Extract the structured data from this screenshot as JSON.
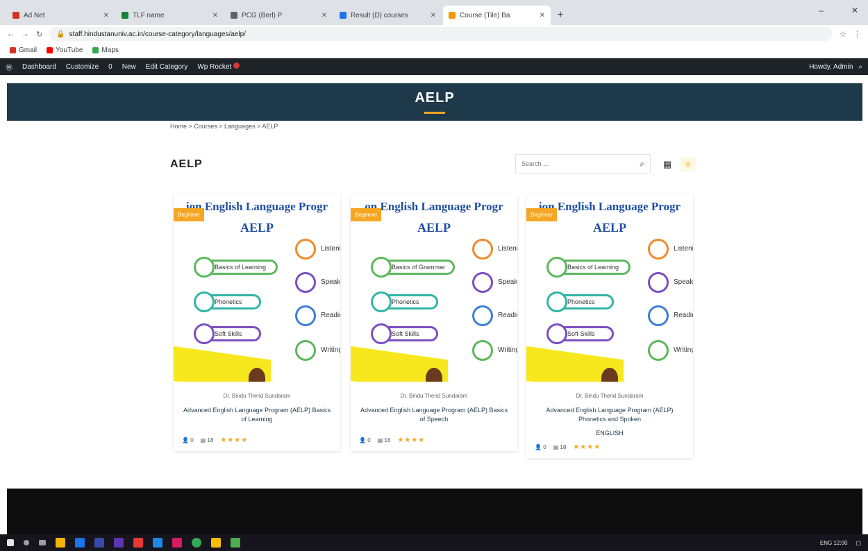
{
  "browser": {
    "tabs": [
      {
        "label": "Ad Net",
        "color": "#d93025",
        "active": false
      },
      {
        "label": "TLF name",
        "color": "#188038",
        "active": false
      },
      {
        "label": "PCG (Berl) P",
        "color": "#5f6368",
        "active": false
      },
      {
        "label": "Result (D) courses",
        "color": "#1a73e8",
        "active": false
      },
      {
        "label": "Course (Tile) Ba",
        "color": "#f29900",
        "active": true
      }
    ],
    "url": "staff.hindustanuniv.ac.in/course-category/languages/aelp/"
  },
  "bookmarks": [
    {
      "label": "Gmail",
      "color": "#d93025"
    },
    {
      "label": "YouTube",
      "color": "#ff0000"
    },
    {
      "label": "Maps",
      "color": "#34a853"
    }
  ],
  "wpbar": {
    "items": [
      "Dashboard",
      "Customize",
      "0",
      "New",
      "Edit Category",
      "Wp Rocket"
    ],
    "right": "Howdy, Admin"
  },
  "site": {
    "title": "AELP"
  },
  "breadcrumb": "Home > Courses > Languages > AELP",
  "page": {
    "heading": "AELP",
    "search_placeholder": "Search ..."
  },
  "courses": [
    {
      "badge": "Beginner",
      "banner": "ion English Language Progr",
      "program": "AELP",
      "modules": [
        "Basics of Learning",
        "Phonetics",
        "Soft Skills"
      ],
      "skills": [
        "Listening",
        "Speaking",
        "Reading",
        "Writing"
      ],
      "instructor": "Dr. Bindu Therid Sundaram",
      "title": "Advanced English Language Program (AELP) Basics of Learning",
      "extra": "",
      "students": "0",
      "lessons": "18",
      "rating": "★★★★"
    },
    {
      "badge": "Beginner",
      "banner": "on English Language Progr",
      "program": "AELP",
      "modules": [
        "Basics of Grammar",
        "Phonetics",
        "Soft Skills"
      ],
      "skills": [
        "Listening",
        "Speaking",
        "Reading",
        "Writing"
      ],
      "instructor": "Dr. Bindu Therid Sundaram",
      "title": "Advanced English Language Program (AELP) Basics of Speech",
      "extra": "",
      "students": "0",
      "lessons": "18",
      "rating": "★★★★"
    },
    {
      "badge": "Beginner",
      "banner": "ion English Language Progr",
      "program": "AELP",
      "modules": [
        "Basics of Learning",
        "Phonetics",
        "Soft Skills"
      ],
      "skills": [
        "Listening",
        "Speaking",
        "Reading",
        "Writing"
      ],
      "instructor": "Dr. Bindu Therid Sundaram",
      "title": "Advanced English Language Program (AELP) Phonetics and Spoken",
      "extra": "ENGLISH",
      "students": "0",
      "lessons": "18",
      "rating": "★★★★"
    }
  ],
  "taskbar": {
    "tray": "ENG 12:00"
  },
  "colors": {
    "header": "#1e3a4a",
    "accent": "#f5a623",
    "wpbar": "#1d2327"
  }
}
